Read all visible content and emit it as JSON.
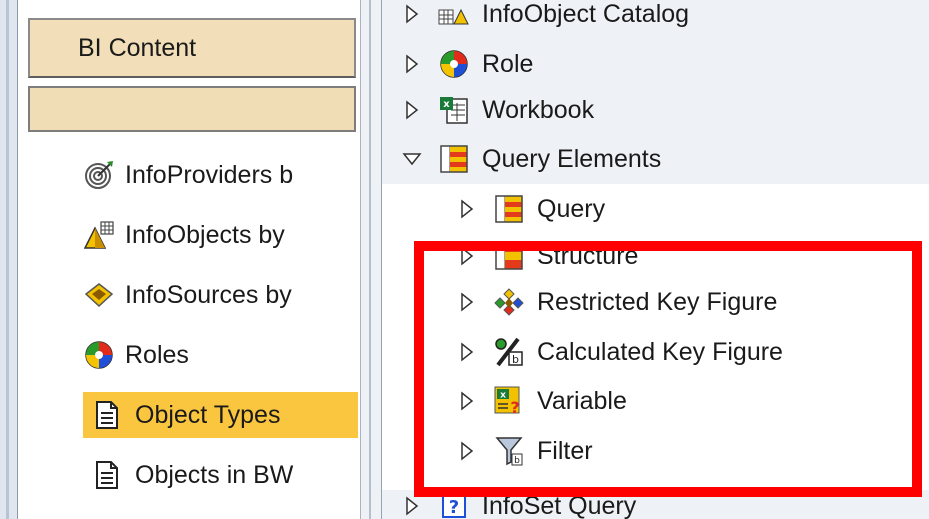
{
  "left_nav": {
    "header": "BI Content",
    "items": [
      {
        "label": "InfoProviders b",
        "icon": "target-icon"
      },
      {
        "label": "InfoObjects by",
        "icon": "infoobject-icon"
      },
      {
        "label": "InfoSources by",
        "icon": "infosource-icon"
      },
      {
        "label": "Roles",
        "icon": "role-icon"
      },
      {
        "label": "Object Types",
        "icon": "document-icon",
        "selected": true
      },
      {
        "label": "Objects in BW",
        "icon": "document-icon"
      }
    ]
  },
  "tree": {
    "items": [
      {
        "label": "InfoObject Catalog",
        "icon": "infoobject-catalog-icon",
        "expanded": false
      },
      {
        "label": "Role",
        "icon": "role-icon",
        "expanded": false
      },
      {
        "label": "Workbook",
        "icon": "workbook-icon",
        "expanded": false
      },
      {
        "label": "Query Elements",
        "icon": "query-icon",
        "expanded": true
      },
      {
        "label": "Query",
        "icon": "query-icon",
        "expanded": false
      },
      {
        "label": "Structure",
        "icon": "structure-icon",
        "expanded": false
      },
      {
        "label": "Restricted Key Figure",
        "icon": "restricted-key-figure-icon",
        "expanded": false
      },
      {
        "label": "Calculated Key Figure",
        "icon": "calculated-key-figure-icon",
        "expanded": false
      },
      {
        "label": "Variable",
        "icon": "variable-icon",
        "expanded": false
      },
      {
        "label": "Filter",
        "icon": "filter-icon",
        "expanded": false
      },
      {
        "label": "InfoSet Query",
        "icon": "infoset-query-icon",
        "expanded": false
      }
    ]
  },
  "colors": {
    "tab_bg": "#f2deb8",
    "selected_bg": "#fbc63f",
    "highlight": "#ff0000",
    "panel_bg": "#eef2f7"
  }
}
